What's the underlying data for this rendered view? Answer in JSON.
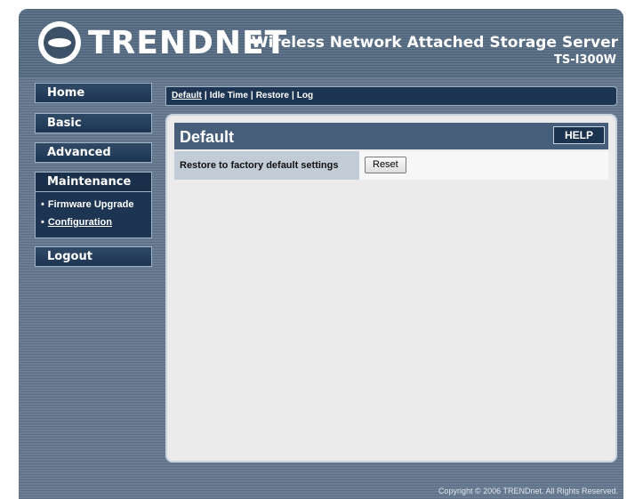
{
  "brand": {
    "logo_text": "TRENDNET",
    "product_title": "Wireless Network Attached Storage Server",
    "model": "TS-I300W"
  },
  "sidebar": {
    "items": [
      {
        "label": "Home"
      },
      {
        "label": "Basic"
      },
      {
        "label": "Advanced"
      },
      {
        "label": "Maintenance"
      },
      {
        "label": "Logout"
      }
    ],
    "submenu": [
      {
        "label": "Firmware Upgrade"
      },
      {
        "label": "Configuration"
      }
    ]
  },
  "tabs": [
    {
      "label": "Default"
    },
    {
      "label": "Idle Time"
    },
    {
      "label": "Restore"
    },
    {
      "label": "Log"
    }
  ],
  "panel": {
    "title": "Default",
    "help_label": "HELP",
    "setting_label": "Restore to factory default settings",
    "reset_label": "Reset"
  },
  "footer": {
    "copyright": "Copyright © 2006 TRENDnet. All Rights Reserved."
  }
}
